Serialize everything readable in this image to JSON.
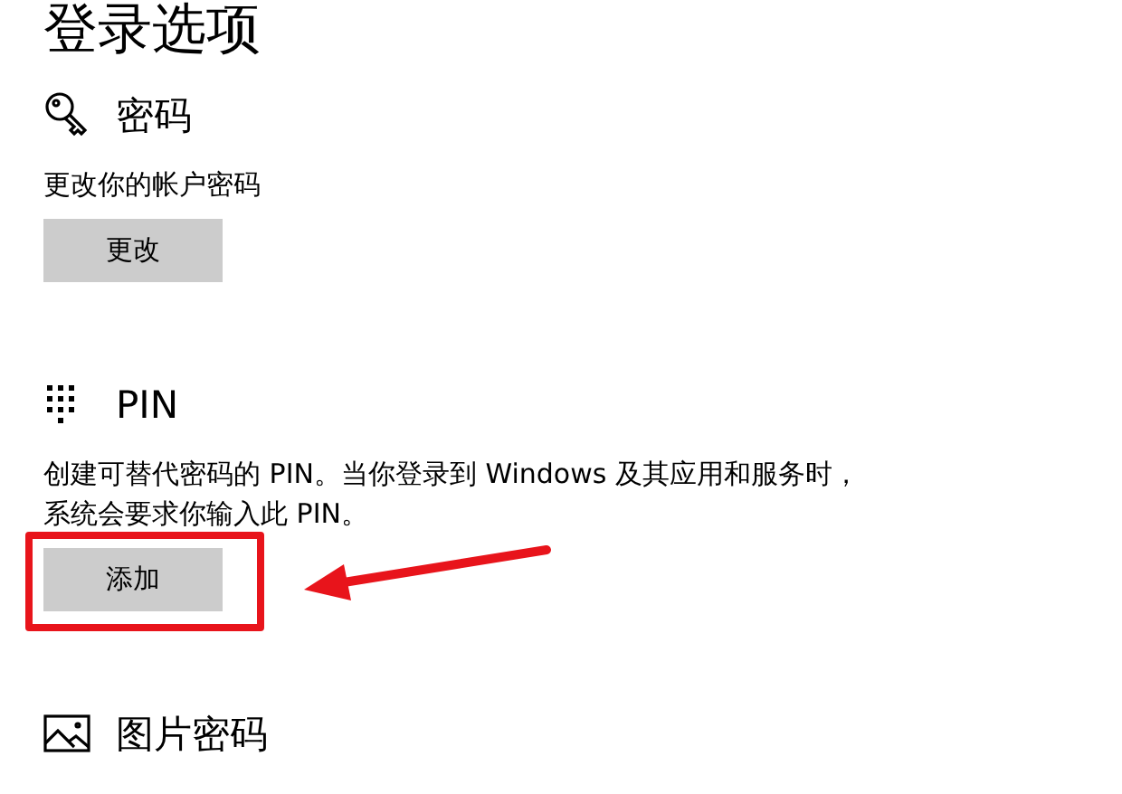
{
  "page": {
    "title": "登录选项"
  },
  "sections": [
    {
      "kind": "key",
      "heading": "密码",
      "description": "更改你的帐户密码",
      "button": "更改",
      "highlighted": false
    },
    {
      "kind": "keypad",
      "heading": "PIN",
      "description": "创建可替代密码的 PIN。当你登录到 Windows 及其应用和服务时，系统会要求你输入此 PIN。",
      "button": "添加",
      "highlighted": true
    },
    {
      "kind": "image",
      "heading": "图片密码"
    }
  ]
}
